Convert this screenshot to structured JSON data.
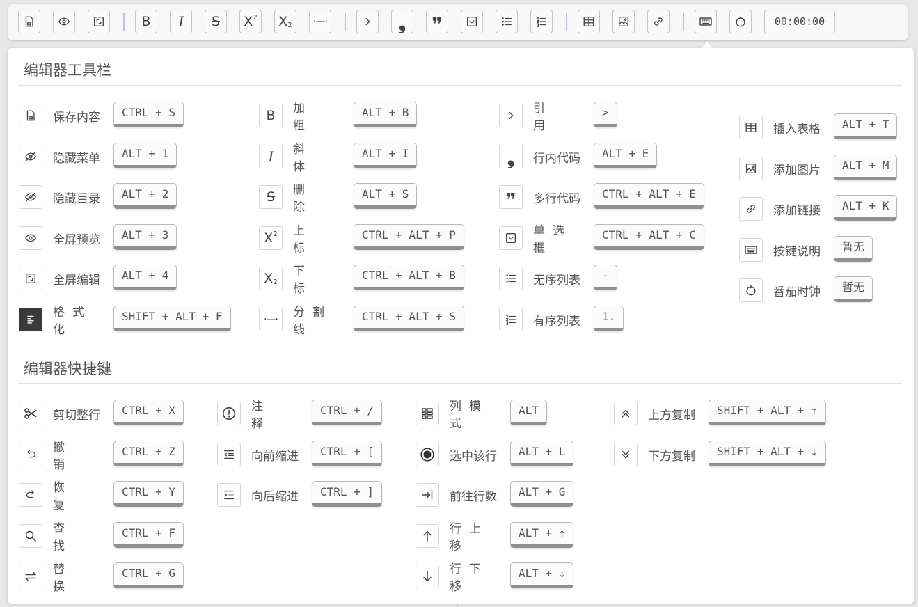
{
  "toolbar": {
    "items": [
      {
        "name": "save-icon"
      },
      {
        "name": "eye-icon"
      },
      {
        "name": "fullscreen-icon"
      },
      {
        "name": "bold-icon",
        "glyph": "B"
      },
      {
        "name": "italic-icon",
        "glyph": "I"
      },
      {
        "name": "strikethrough-icon",
        "glyph": "S"
      },
      {
        "name": "superscript-icon",
        "glyph": "X²"
      },
      {
        "name": "subscript-icon",
        "glyph": "X₂"
      },
      {
        "name": "divider-icon",
        "glyph": "·—·"
      },
      {
        "name": "quote-icon",
        "glyph": ">"
      },
      {
        "name": "inline-code-icon",
        "glyph": "❟"
      },
      {
        "name": "code-block-icon",
        "glyph": "❞"
      },
      {
        "name": "checkbox-icon"
      },
      {
        "name": "unordered-list-icon"
      },
      {
        "name": "ordered-list-icon"
      },
      {
        "name": "table-icon"
      },
      {
        "name": "image-icon"
      },
      {
        "name": "link-icon"
      },
      {
        "name": "keyboard-icon"
      },
      {
        "name": "pomodoro-clock-icon"
      }
    ],
    "timer": "00:00:00"
  },
  "toolbar_section": {
    "title": "编辑器工具栏",
    "columns": [
      [
        {
          "icon": "save-icon",
          "label": "保存内容",
          "key": "CTRL + S"
        },
        {
          "icon": "eye-off-icon",
          "label": "隐藏菜单",
          "key": "ALT + 1"
        },
        {
          "icon": "eye-off-icon",
          "label": "隐藏目录",
          "key": "ALT + 2"
        },
        {
          "icon": "eye-icon",
          "label": "全屏预览",
          "key": "ALT + 3"
        },
        {
          "icon": "fullscreen-icon",
          "label": "全屏编辑",
          "key": "ALT + 4"
        },
        {
          "icon": "format-icon",
          "label": "格式化",
          "key": "SHIFT + ALT + F"
        }
      ],
      [
        {
          "icon": "bold-icon",
          "label": "加粗",
          "key": "ALT + B"
        },
        {
          "icon": "italic-icon",
          "label": "斜体",
          "key": "ALT + I"
        },
        {
          "icon": "strikethrough-icon",
          "label": "删除",
          "key": "ALT + S"
        },
        {
          "icon": "superscript-icon",
          "label": "上标",
          "key": "CTRL + ALT + P"
        },
        {
          "icon": "subscript-icon",
          "label": "下标",
          "key": "CTRL + ALT + B"
        },
        {
          "icon": "divider-icon",
          "label": "分割线",
          "key": "CTRL + ALT + S"
        }
      ],
      [
        {
          "icon": "quote-icon",
          "label": "引用",
          "key": ">"
        },
        {
          "icon": "inline-code-icon",
          "label": "行内代码",
          "key": "ALT + E"
        },
        {
          "icon": "code-block-icon",
          "label": "多行代码",
          "key": "CTRL + ALT + E"
        },
        {
          "icon": "checkbox-icon",
          "label": "单选框",
          "key": "CTRL + ALT + C"
        },
        {
          "icon": "unordered-list-icon",
          "label": "无序列表",
          "key": "-"
        },
        {
          "icon": "ordered-list-icon",
          "label": "有序列表",
          "key": "1."
        }
      ],
      [
        {
          "icon": "table-icon",
          "label": "插入表格",
          "key": "ALT + T"
        },
        {
          "icon": "image-icon",
          "label": "添加图片",
          "key": "ALT + M"
        },
        {
          "icon": "link-icon",
          "label": "添加链接",
          "key": "ALT + K"
        },
        {
          "icon": "keyboard-icon",
          "label": "按键说明",
          "key": "暂无"
        },
        {
          "icon": "pomodoro-clock-icon",
          "label": "番茄时钟",
          "key": "暂无"
        }
      ]
    ]
  },
  "shortcut_section": {
    "title": "编辑器快捷键",
    "columns": [
      [
        {
          "icon": "scissors-icon",
          "label": "剪切整行",
          "key": "CTRL + X"
        },
        {
          "icon": "undo-icon",
          "label": "撤销",
          "key": "CTRL + Z"
        },
        {
          "icon": "redo-icon",
          "label": "恢复",
          "key": "CTRL + Y"
        },
        {
          "icon": "search-icon",
          "label": "查找",
          "key": "CTRL + F"
        },
        {
          "icon": "replace-icon",
          "label": "替换",
          "key": "CTRL + G"
        }
      ],
      [
        {
          "icon": "comment-icon",
          "label": "注释",
          "key": "CTRL + /"
        },
        {
          "icon": "outdent-icon",
          "label": "向前缩进",
          "key": "CTRL + ["
        },
        {
          "icon": "indent-icon",
          "label": "向后缩进",
          "key": "CTRL + ]"
        }
      ],
      [
        {
          "icon": "column-mode-icon",
          "label": "列模式",
          "key": "ALT"
        },
        {
          "icon": "select-line-icon",
          "label": "选中该行",
          "key": "ALT + L"
        },
        {
          "icon": "goto-line-icon",
          "label": "前往行数",
          "key": "ALT + G"
        },
        {
          "icon": "arrow-up-icon",
          "label": "行上移",
          "key": "ALT + ↑"
        },
        {
          "icon": "arrow-down-icon",
          "label": "行下移",
          "key": "ALT + ↓"
        }
      ],
      [
        {
          "icon": "copy-up-icon",
          "label": "上方复制",
          "key": "SHIFT + ALT + ↑"
        },
        {
          "icon": "copy-down-icon",
          "label": "下方复制",
          "key": "SHIFT + ALT + ↓"
        }
      ]
    ]
  }
}
